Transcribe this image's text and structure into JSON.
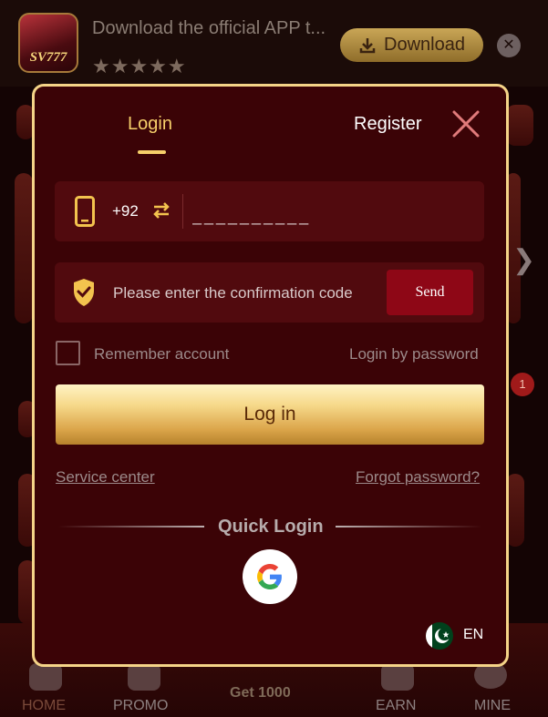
{
  "background": {
    "banner": {
      "logo_text": "SV777",
      "title": "Download the official APP t...",
      "stars": "★★★★★",
      "download_label": "Download",
      "close_symbol": "✕"
    },
    "badge_count": "1",
    "bottom_nav": {
      "home": "HOME",
      "promo": "PROMO",
      "bonus": "Get 1000",
      "earn": "EARN",
      "mine": "MINE"
    }
  },
  "modal": {
    "tabs": {
      "login": "Login",
      "register": "Register"
    },
    "active_tab": "Login",
    "phone": {
      "country_code": "+92",
      "placeholder": "__________"
    },
    "code": {
      "placeholder": "Please enter the confirmation code",
      "send_label": "Send"
    },
    "remember_label": "Remember account",
    "remember_checked": false,
    "login_by_password": "Login by password",
    "login_button": "Log in",
    "service_center": "Service center",
    "forgot_password": "Forgot password?",
    "quick_login_title": "Quick Login",
    "language": "EN"
  },
  "colors": {
    "accent_gold": "#f6cf6a",
    "modal_bg": "#3b0306",
    "field_bg": "#510a0e",
    "send_button": "#8e0716",
    "modal_border": "#f5d488"
  },
  "icons": [
    "phone-icon",
    "swap-icon",
    "shield-check-icon",
    "close-icon",
    "google-icon",
    "pakistan-flag-icon",
    "download-icon"
  ]
}
